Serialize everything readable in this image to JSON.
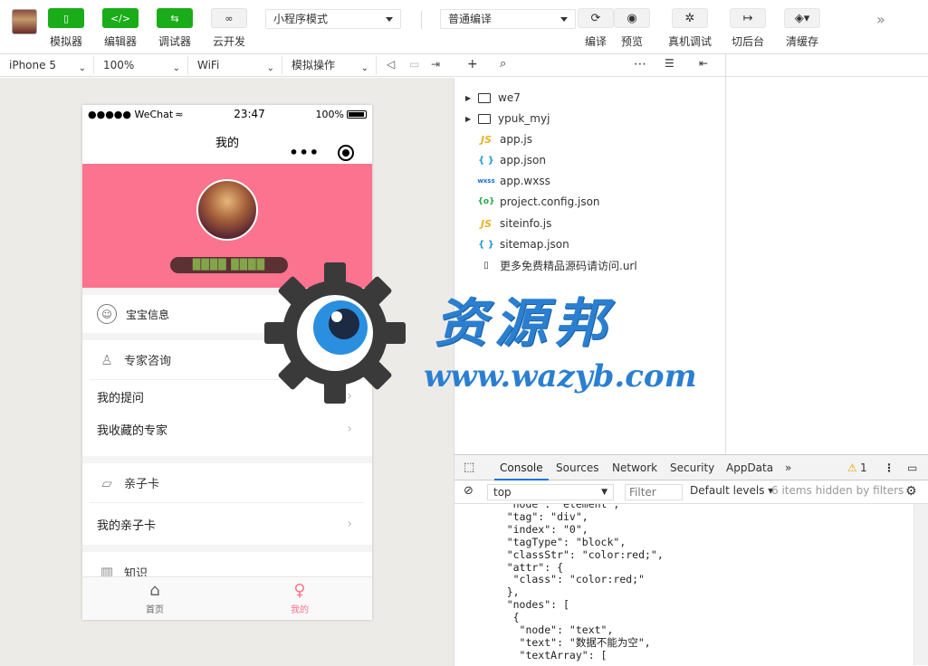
{
  "toolbar": {
    "simulator": "模拟器",
    "editor": "编辑器",
    "debugger": "调试器",
    "cloud": "云开发",
    "mode": "小程序模式",
    "compile_mode": "普通编译",
    "compile": "编译",
    "preview": "预览",
    "real_debug": "真机调试",
    "background": "切后台",
    "clear_cache": "清缓存"
  },
  "subbar": {
    "device": "iPhone 5",
    "zoom": "100%",
    "network": "WiFi",
    "simulate": "模拟操作"
  },
  "phone": {
    "carrier": "●●●●● WeChat",
    "time": "23:47",
    "battery": "100%",
    "nav_title": "我的",
    "nickname": "████ ████",
    "baby_info": "宝宝信息",
    "expert_head": "专家咨询",
    "my_questions": "我的提问",
    "fav_experts": "我收藏的专家",
    "family_head": "亲子卡",
    "my_family_card": "我的亲子卡",
    "knowledge_head": "知识",
    "tab_home": "首页",
    "tab_mine": "我的"
  },
  "files": [
    {
      "name": "we7",
      "type": "folder"
    },
    {
      "name": "ypuk_myj",
      "type": "folder"
    },
    {
      "name": "app.js",
      "type": "js",
      "icon": "JS"
    },
    {
      "name": "app.json",
      "type": "json",
      "icon": "{ }"
    },
    {
      "name": "app.wxss",
      "type": "wxss",
      "icon": "wxss"
    },
    {
      "name": "project.config.json",
      "type": "cfg",
      "icon": "{o}"
    },
    {
      "name": "siteinfo.js",
      "type": "js",
      "icon": "JS"
    },
    {
      "name": "sitemap.json",
      "type": "json",
      "icon": "{ }"
    },
    {
      "name": "更多免费精品源码请访问.url",
      "type": "doc",
      "icon": "▯"
    }
  ],
  "devtools": {
    "tabs": [
      "Console",
      "Sources",
      "Network",
      "Security",
      "AppData"
    ],
    "warnings": "1",
    "context": "top",
    "filter_placeholder": "Filter",
    "levels": "Default levels",
    "hidden": "6 items hidden by filters",
    "console_lines": "    \"node\": \"element\",\n    \"tag\": \"div\",\n    \"index\": \"0\",\n    \"tagType\": \"block\",\n    \"classStr\": \"color:red;\",\n    \"attr\": {\n     \"class\": \"color:red;\"\n    },\n    \"nodes\": [\n     {\n      \"node\": \"text\",\n      \"text\": \"数据不能为空\",\n      \"textArray\": ["
  },
  "watermark": {
    "title": "资源邦",
    "url": "www.wazyb.com"
  }
}
